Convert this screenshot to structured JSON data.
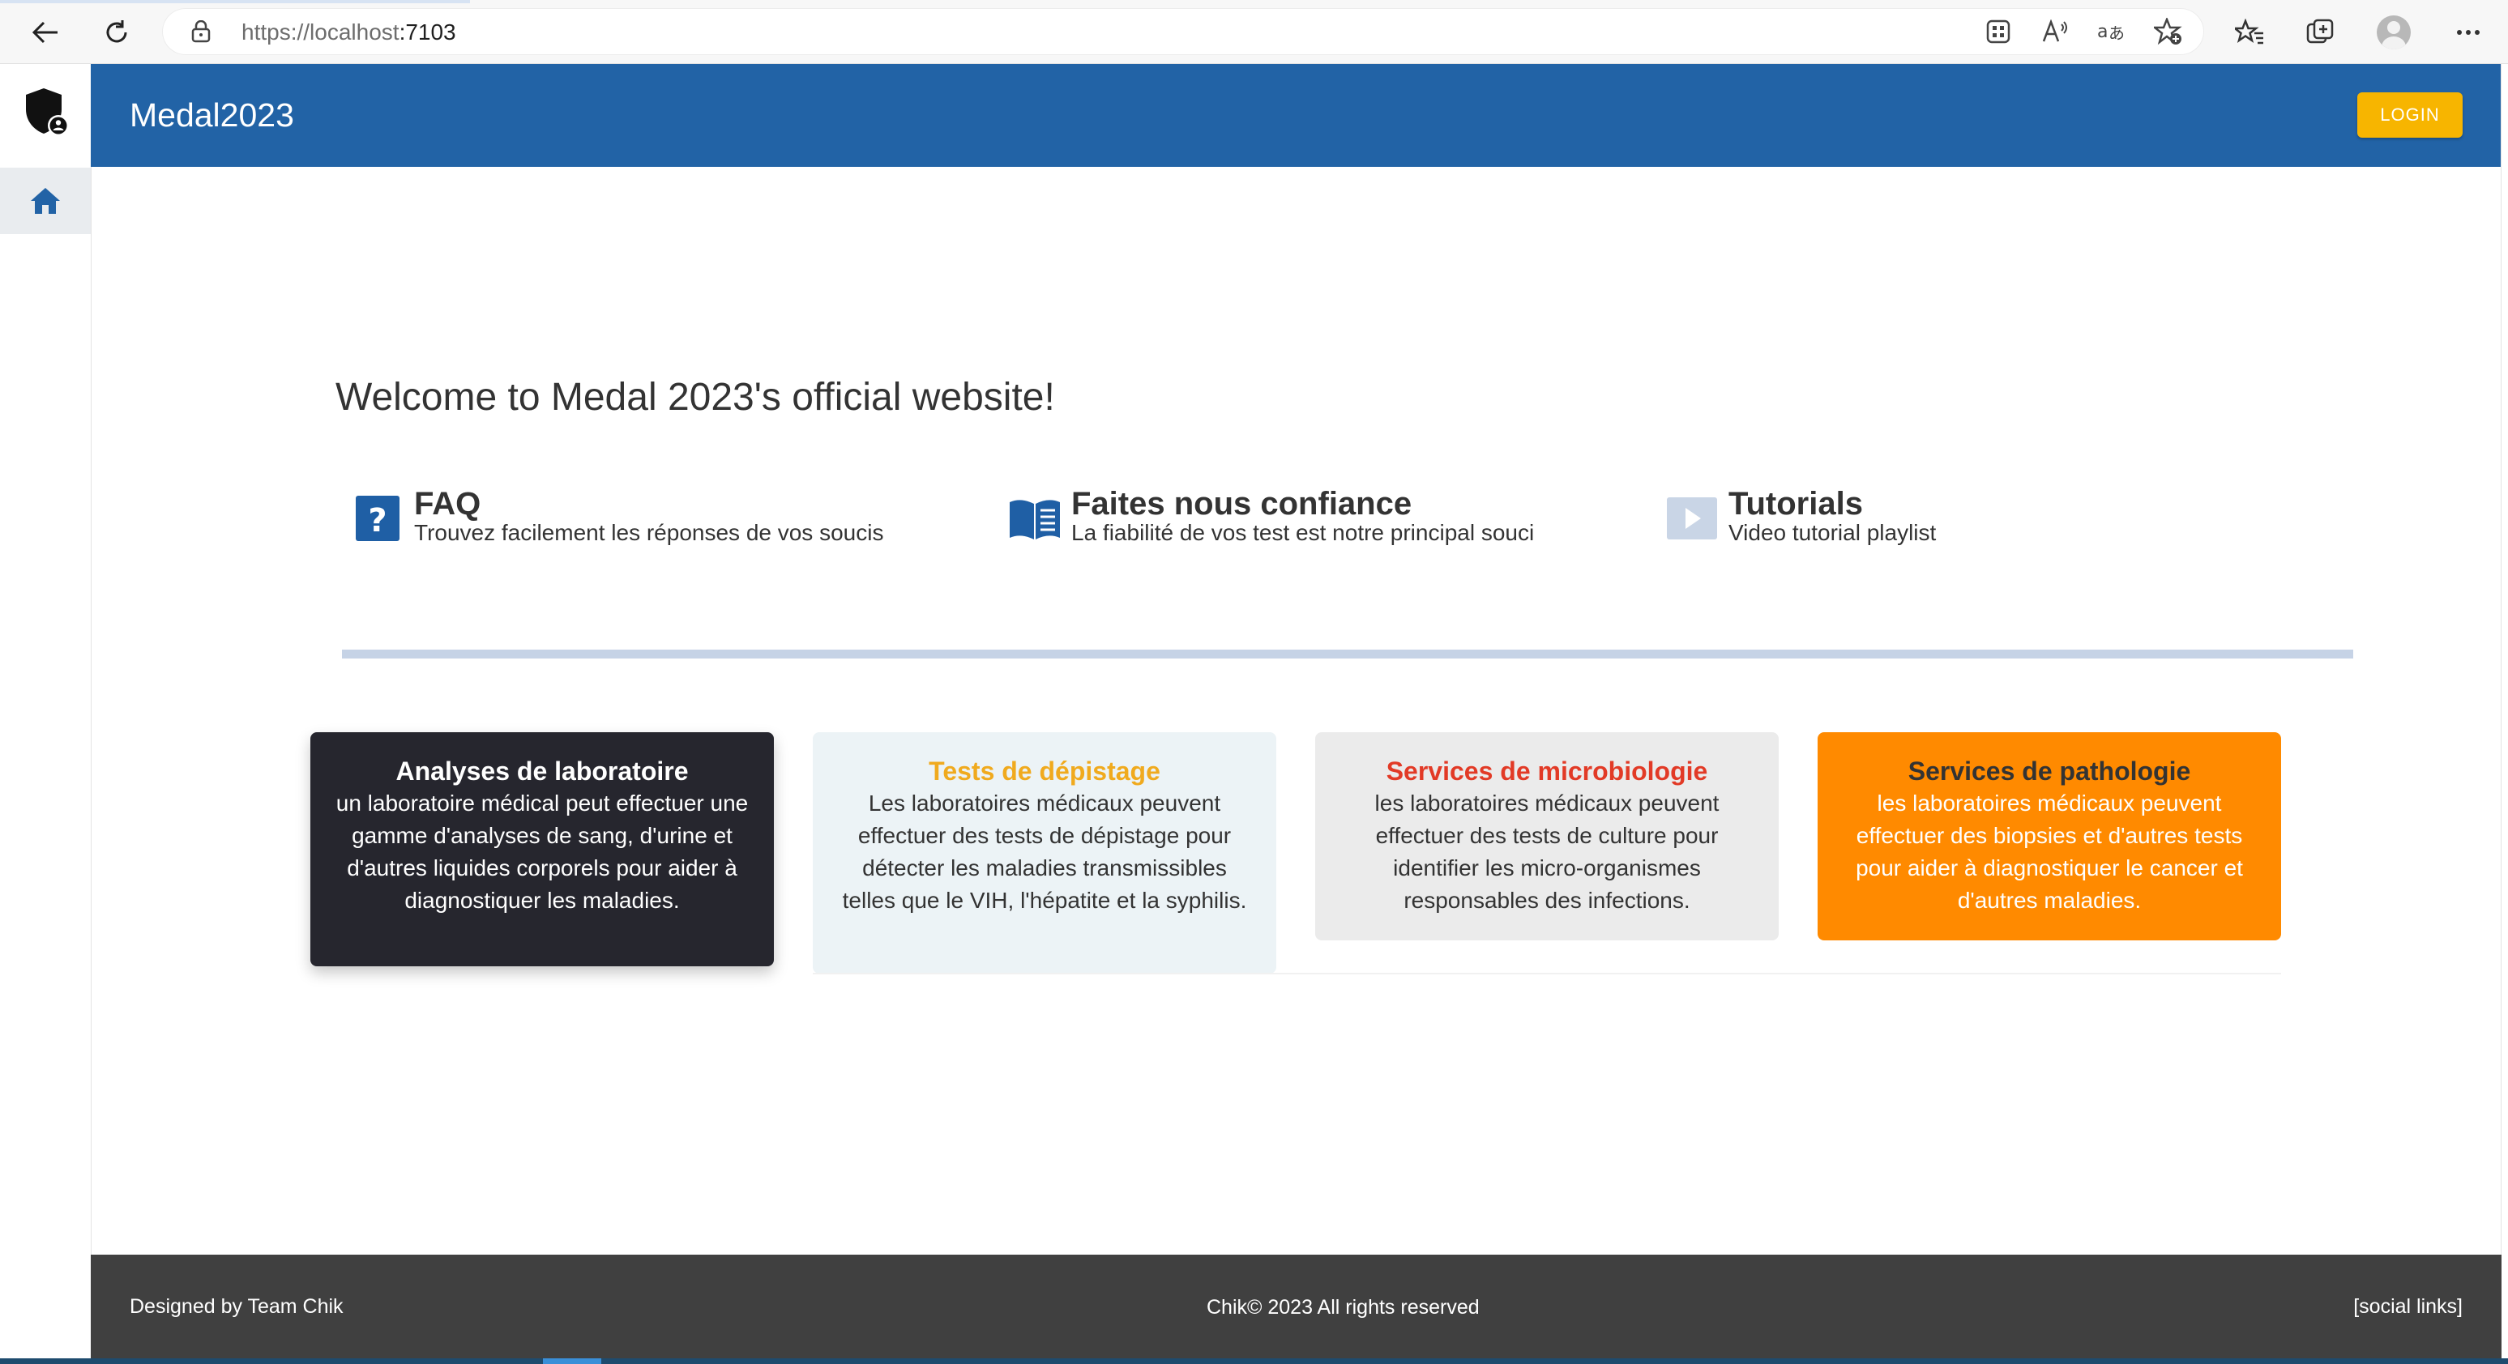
{
  "browser": {
    "url_host": "https://localhost",
    "url_port": ":7103"
  },
  "header": {
    "title": "Medal2023",
    "login_label": "LOGIN"
  },
  "main": {
    "welcome": "Welcome to Medal 2023's official website!",
    "features": [
      {
        "title": "FAQ",
        "text": "Trouvez facilement les réponses de vos soucis",
        "icon": "question-icon"
      },
      {
        "title": "Faites nous confiance",
        "text": "La fiabilité de vos test est notre principal souci",
        "icon": "open-book-icon"
      },
      {
        "title": "Tutorials",
        "text": "Video tutorial playlist",
        "icon": "play-video-icon"
      }
    ],
    "cards": [
      {
        "title": "Analyses de laboratoire",
        "text": "un laboratoire médical peut effectuer une gamme d'analyses de sang, d'urine et d'autres liquides corporels pour aider à diagnostiquer les maladies."
      },
      {
        "title": "Tests de dépistage",
        "text": "Les laboratoires médicaux peuvent effectuer des tests de dépistage pour détecter les maladies transmissibles telles que le VIH, l'hépatite et la syphilis."
      },
      {
        "title": "Services de microbiologie",
        "text": "les laboratoires médicaux peuvent effectuer des tests de culture pour identifier les micro-organismes responsables des infections."
      },
      {
        "title": "Services de pathologie",
        "text": "les laboratoires médicaux peuvent effectuer des biopsies et d'autres tests pour aider à diagnostiquer le cancer et d'autres maladies."
      }
    ]
  },
  "footer": {
    "left": "Designed by Team Chik",
    "center": "Chik© 2023  All rights reserved",
    "right": "[social links]"
  },
  "colors": {
    "header_bg": "#2263a6",
    "login_bg": "#f7b500",
    "footer_bg": "#404040",
    "card_dark": "#26262e",
    "card_orange": "#ff8a00"
  }
}
